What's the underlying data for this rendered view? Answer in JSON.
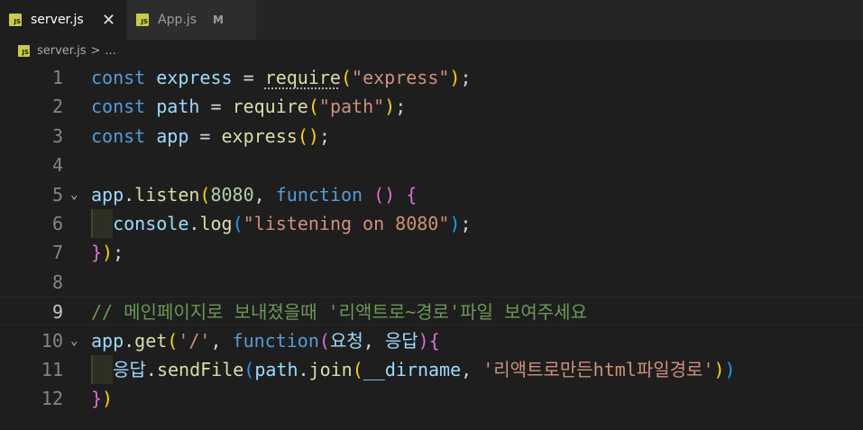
{
  "tabs": [
    {
      "badge": "JS",
      "label": "server.js",
      "close": "✕"
    },
    {
      "badge": "JS",
      "label": "App.js",
      "modified": "M"
    }
  ],
  "breadcrumb": {
    "badge": "JS",
    "file": "server.js",
    "sep": ">",
    "more": "..."
  },
  "lines": [
    {
      "num": "1",
      "tokens": [
        [
          "kw",
          "const"
        ],
        [
          "pl",
          " "
        ],
        [
          "var",
          "express"
        ],
        [
          "pl",
          " = "
        ],
        [
          "fn",
          "require"
        ],
        [
          "b1",
          "("
        ],
        [
          "str",
          "\"express\""
        ],
        [
          "b1",
          ")"
        ],
        [
          "pl",
          ";"
        ]
      ]
    },
    {
      "num": "2",
      "tokens": [
        [
          "kw",
          "const"
        ],
        [
          "pl",
          " "
        ],
        [
          "var",
          "path"
        ],
        [
          "pl",
          " = "
        ],
        [
          "fn",
          "require"
        ],
        [
          "b1",
          "("
        ],
        [
          "str",
          "\"path\""
        ],
        [
          "b1",
          ")"
        ],
        [
          "pl",
          ";"
        ]
      ]
    },
    {
      "num": "3",
      "tokens": [
        [
          "kw",
          "const"
        ],
        [
          "pl",
          " "
        ],
        [
          "var",
          "app"
        ],
        [
          "pl",
          " = "
        ],
        [
          "fn",
          "express"
        ],
        [
          "b1",
          "()"
        ],
        [
          "pl",
          ";"
        ]
      ]
    },
    {
      "num": "4",
      "tokens": []
    },
    {
      "num": "5",
      "fold": "⌄",
      "tokens": [
        [
          "var",
          "app"
        ],
        [
          "pl",
          "."
        ],
        [
          "fn",
          "listen"
        ],
        [
          "b1",
          "("
        ],
        [
          "num",
          "8080"
        ],
        [
          "pl",
          ", "
        ],
        [
          "kw",
          "function"
        ],
        [
          "pl",
          " "
        ],
        [
          "b2",
          "()"
        ],
        [
          "pl",
          " "
        ],
        [
          "b2",
          "{"
        ]
      ]
    },
    {
      "num": "6",
      "guide": true,
      "tokens": [
        [
          "pl",
          "  "
        ],
        [
          "var",
          "console"
        ],
        [
          "pl",
          "."
        ],
        [
          "fn",
          "log"
        ],
        [
          "b3",
          "("
        ],
        [
          "str",
          "\"listening on 8080\""
        ],
        [
          "b3",
          ")"
        ],
        [
          "pl",
          ";"
        ]
      ]
    },
    {
      "num": "7",
      "tokens": [
        [
          "b2",
          "}"
        ],
        [
          "b1",
          ")"
        ],
        [
          "pl",
          ";"
        ]
      ]
    },
    {
      "num": "8",
      "tokens": []
    },
    {
      "num": "9",
      "current": true,
      "tokens": [
        [
          "cm",
          "// 메인페이지로 보내졌을때 '리액트로~경로'파일 보여주세요"
        ]
      ]
    },
    {
      "num": "10",
      "fold": "⌄",
      "tokens": [
        [
          "var",
          "app"
        ],
        [
          "pl",
          "."
        ],
        [
          "fn",
          "get"
        ],
        [
          "b1",
          "("
        ],
        [
          "str",
          "'/'"
        ],
        [
          "pl",
          ", "
        ],
        [
          "kw",
          "function"
        ],
        [
          "b2",
          "("
        ],
        [
          "var",
          "요청"
        ],
        [
          "pl",
          ", "
        ],
        [
          "var",
          "응답"
        ],
        [
          "b2",
          ")"
        ],
        [
          "b2",
          "{"
        ]
      ]
    },
    {
      "num": "11",
      "guide": true,
      "tokens": [
        [
          "pl",
          "  "
        ],
        [
          "var",
          "응답"
        ],
        [
          "pl",
          "."
        ],
        [
          "fn",
          "sendFile"
        ],
        [
          "b3",
          "("
        ],
        [
          "var",
          "path"
        ],
        [
          "pl",
          "."
        ],
        [
          "fn",
          "join"
        ],
        [
          "b1",
          "("
        ],
        [
          "var",
          "__dirname"
        ],
        [
          "pl",
          ", "
        ],
        [
          "str",
          "'리액트로만든html파일경로'"
        ],
        [
          "b1",
          ")"
        ],
        [
          "b3",
          ")"
        ]
      ]
    },
    {
      "num": "12",
      "tokens": [
        [
          "b2",
          "}"
        ],
        [
          "b1",
          ")"
        ]
      ]
    }
  ]
}
